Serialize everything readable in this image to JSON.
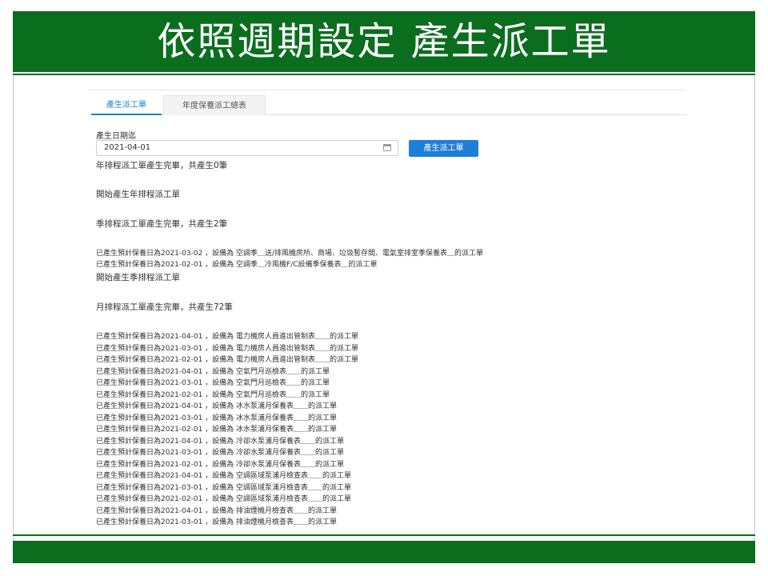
{
  "slide": {
    "title": "依照週期設定 產生派工單",
    "colors": {
      "brand_green": "#0a6e1e",
      "accent_blue": "#1e7fd8"
    }
  },
  "tabs": [
    {
      "label": "產生派工單",
      "active": true
    },
    {
      "label": "年度保養派工總表",
      "active": false
    }
  ],
  "form": {
    "date_label": "產生日期迄",
    "date_value": "2021-04-01",
    "calendar_icon": "calendar-icon",
    "generate_button": "產生派工單"
  },
  "log": {
    "year_done": "年排程派工單產生完畢，共產生0筆",
    "year_start": "開始產生年排程派工單",
    "season_done": "季排程派工單產生完畢，共產生2筆",
    "season_items": [
      "已產生預計保養日為2021-03-02 ，設備為 空調季＿送/排風機房所、商場、垃圾暫存間、電氣室排室季保養表＿的派工單",
      "已產生預計保養日為2021-02-01 ，設備為 空調季＿冷風機F/C設備季保養表＿的派工單"
    ],
    "season_start": "開始產生季排程派工單",
    "month_done": "月排程派工單產生完畢，共產生72筆",
    "month_items": [
      "已產生預計保養日為2021-04-01 ，設備為 電力機房人員進出管制表＿＿的派工單",
      "已產生預計保養日為2021-03-01 ，設備為 電力機房人員進出管制表＿＿的派工單",
      "已產生預計保養日為2021-02-01 ，設備為 電力機房人員進出管制表＿＿的派工單",
      "已產生預計保養日為2021-04-01 ，設備為 空氣門月巡檢表＿＿的派工單",
      "已產生預計保養日為2021-03-01 ，設備為 空氣門月巡檢表＿＿的派工單",
      "已產生預計保養日為2021-02-01 ，設備為 空氣門月巡檢表＿＿的派工單",
      "已產生預計保養日為2021-04-01 ，設備為 冰水泵浦月保養表＿＿的派工單",
      "已產生預計保養日為2021-03-01 ，設備為 冰水泵浦月保養表＿＿的派工單",
      "已產生預計保養日為2021-02-01 ，設備為 冰水泵浦月保養表＿＿的派工單",
      "已產生預計保養日為2021-04-01 ，設備為 冷卻水泵浦月保養表＿＿的派工單",
      "已產生預計保養日為2021-03-01 ，設備為 冷卻水泵浦月保養表＿＿的派工單",
      "已產生預計保養日為2021-02-01 ，設備為 冷卻水泵浦月保養表＿＿的派工單",
      "已產生預計保養日為2021-04-01 ，設備為 空調區域泵浦月檢查表＿＿的派工單",
      "已產生預計保養日為2021-03-01 ，設備為 空調區域泵浦月檢查表＿＿的派工單",
      "已產生預計保養日為2021-02-01 ，設備為 空調區域泵浦月檢查表＿＿的派工單",
      "已產生預計保養日為2021-04-01 ，設備為 排油煙機月檢查表＿＿的派工單",
      "已產生預計保養日為2021-03-01 ，設備為 排油煙機月檢查表＿＿的派工單"
    ]
  }
}
